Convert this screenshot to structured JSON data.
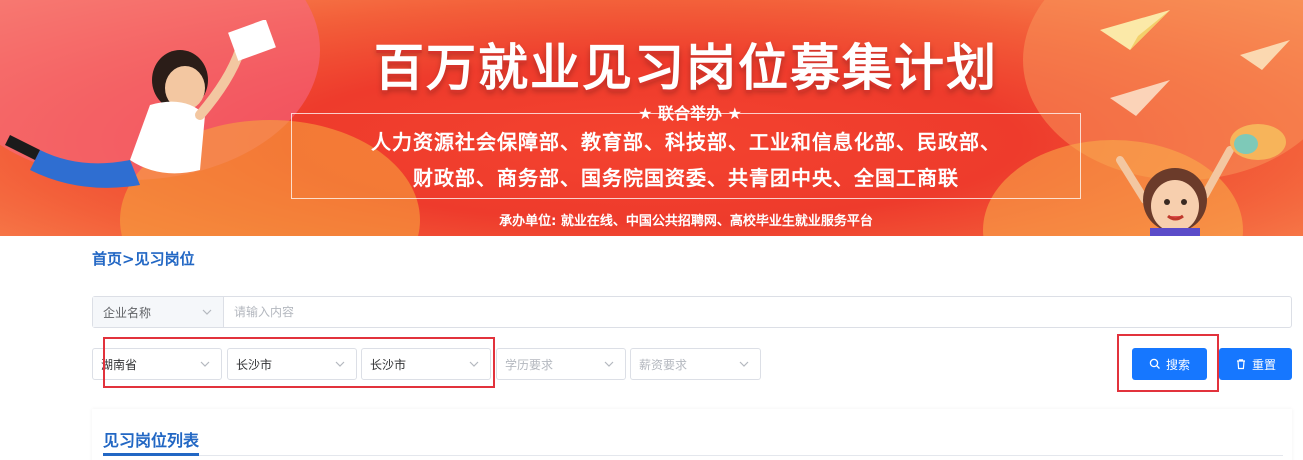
{
  "banner": {
    "title": "百万就业见习岗位募集计划",
    "co_host": "★ 联合举办 ★",
    "ministries_line1": "人力资源社会保障部、教育部、科技部、工业和信息化部、民政部、",
    "ministries_line2": "财政部、商务部、国务院国资委、共青团中央、全国工商联",
    "organizer": "承办单位: 就业在线、中国公共招聘网、高校毕业生就业服务平台"
  },
  "breadcrumb": {
    "home": "首页",
    "separator": ">",
    "current": "见习岗位"
  },
  "search": {
    "company_type_label": "企业名称",
    "keyword_placeholder": "请输入内容",
    "province": "湖南省",
    "city": "长沙市",
    "district": "长沙市",
    "education_placeholder": "学历要求",
    "salary_placeholder": "薪资要求",
    "search_button": "搜索",
    "reset_button": "重置"
  },
  "list": {
    "title": "见习岗位列表"
  },
  "colors": {
    "accent": "#1677ff",
    "link": "#2267c4",
    "highlight_border": "#e2323c",
    "banner_red": "#ee3b2c"
  }
}
